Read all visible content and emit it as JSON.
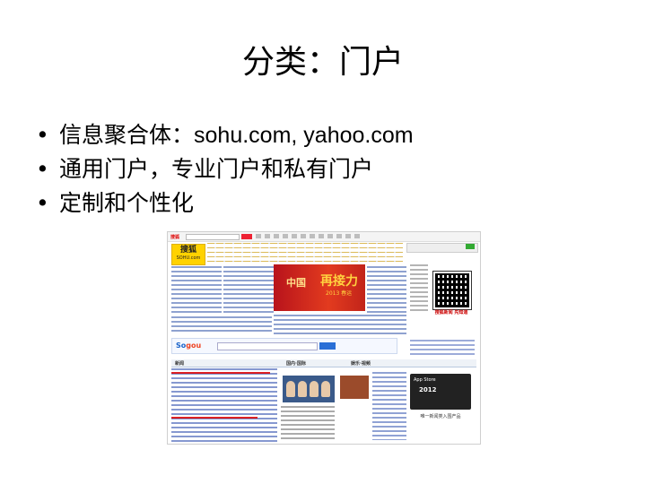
{
  "slide": {
    "title": "分类：门户",
    "bullets": [
      {
        "label": "信息聚合体：",
        "extra": "sohu.com, yahoo.com"
      },
      {
        "label": "通用门户，专业门户和私有门户",
        "extra": ""
      },
      {
        "label": "定制和个性化",
        "extra": ""
      }
    ]
  },
  "portal": {
    "logo_cn": "搜狐",
    "logo_en": "SOHU.com",
    "banner_left": "中国",
    "banner_main": "再接力",
    "banner_sub": "2013 春运",
    "qr_label": "搜狐新闻 先知道",
    "search_brand_a": "So",
    "search_brand_b": "gou",
    "tab_news": "新闻",
    "tab_domestic": "国内·国际",
    "tab_entertainment": "娱乐·视频",
    "ad_store": "App Store",
    "ad_year": "2012",
    "ad_label": "唯一新闻类入围产品",
    "colors": {
      "brand_yellow": "#ffd200",
      "banner_red": "#c2241a",
      "link_blue": "#2244aa",
      "sogou_blue": "#1a63c9"
    }
  }
}
